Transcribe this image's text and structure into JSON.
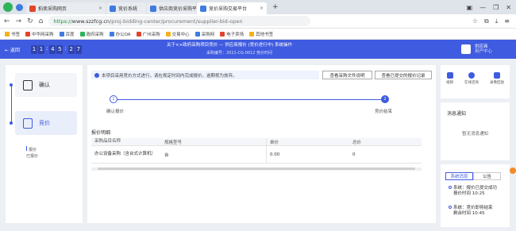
{
  "browser": {
    "tabs": [
      {
        "label": "拍卖采购网页",
        "active": false,
        "color": "#e0452b"
      },
      {
        "label": "竞价系统",
        "active": false,
        "color": "#3f7be0"
      },
      {
        "label": "供应商竞价采购平台",
        "active": false,
        "color": "#3f7be0"
      },
      {
        "label": "竞价采购交易平台",
        "active": true,
        "color": "#3f7be0"
      }
    ],
    "new_tab": "+",
    "url_scheme": "https://",
    "url_domain": "www.szzfcg.cn",
    "url_path": "/proj-bidding-center/procurement/supplier-bid-open",
    "bookmarks": [
      "书签",
      "中华网采购",
      "百度",
      "政府采购",
      "办公OA",
      "广州采购",
      "交易中心",
      "采购网",
      "电子卖场",
      "其他书签"
    ]
  },
  "header": {
    "back_label": "返回",
    "countdown": [
      "1",
      "1",
      "4",
      "5",
      "2",
      "7"
    ],
    "title": "关于××政府采购项目竞价 — 供应商报价 (竞价进行中) 系统操作",
    "subtitle": "采购编号：2021-CG-0012 竞价时间",
    "user_name": "供应商",
    "user_role": "用户中心"
  },
  "steps": [
    {
      "label": "确认"
    },
    {
      "label": "竞价"
    }
  ],
  "left_mini": [
    "报价",
    "已报价"
  ],
  "notice": {
    "text": "本项目采用竞价方式进行，请在规定时间内完成报价，逾期视为放弃。",
    "btn1": "查看采购文件说明",
    "btn2": "查看已提交的报价记录"
  },
  "progress": {
    "step1": "确认报价",
    "step2": "竞价结束",
    "step1_num": "1",
    "step2_num": "2"
  },
  "section_title": "报价明细",
  "table": {
    "headers": [
      "采购品目名称",
      "规格型号",
      "单价",
      "总价"
    ],
    "rows": [
      [
        "办公设备采购（含台式计算机）",
        "台",
        "0.00",
        "0"
      ]
    ]
  },
  "right": {
    "buttons": [
      "视频",
      "在线咨询",
      "录像回放"
    ],
    "card_title": "消息通知",
    "empty_text": "暂无消息通知",
    "tabs": [
      "系统消息",
      "公告"
    ],
    "messages": [
      {
        "line1": "系统：报价已提交成功",
        "line2": "报价时间 10:25"
      },
      {
        "line1": "系统：竞价即将结束",
        "line2": "剩余时间 10:45"
      }
    ]
  },
  "colors": {
    "primary": "#3f5be0",
    "widget": "#f28c28"
  }
}
